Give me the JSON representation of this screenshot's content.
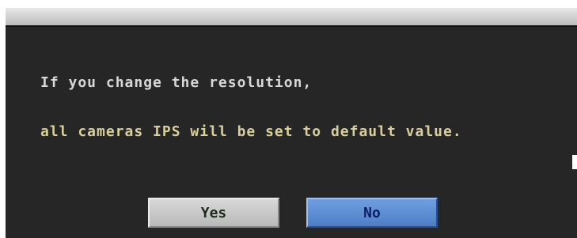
{
  "dialog": {
    "message_line1": "If you change the resolution,",
    "message_line2": "all cameras IPS will be set to default value."
  },
  "buttons": {
    "yes_label": "Yes",
    "no_label": "No"
  },
  "colors": {
    "dialog_bg": "#262626",
    "titlebar": "#c9c9c9",
    "yes_button": "#c8c8c8",
    "no_button": "#5a8ad0",
    "text": "#d8d8d8"
  }
}
